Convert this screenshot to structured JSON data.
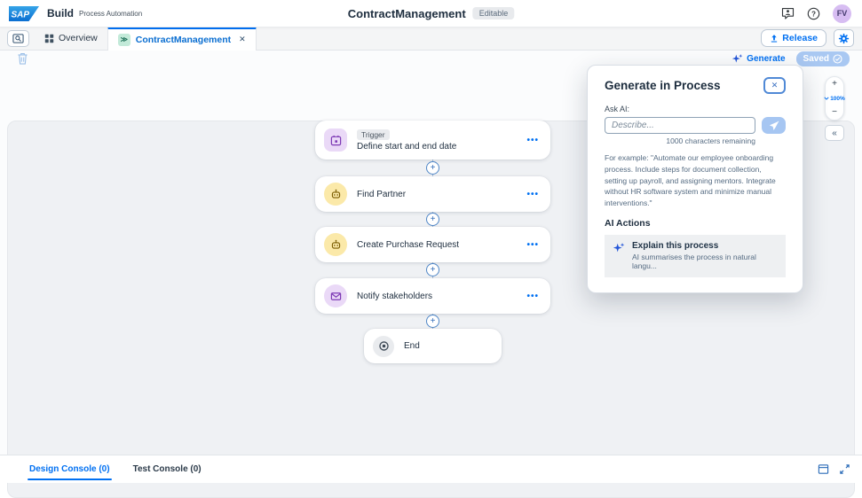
{
  "colors": {
    "accent": "#0070f2",
    "saved_bg": "#a9c8f2",
    "canvas_bg": "#eff1f4",
    "node_purple_bg": "#ead9f7",
    "node_purple_fg": "#7e3bb5",
    "node_yellow_bg": "#fbe9a9",
    "node_yellow_fg": "#7a5c00",
    "node_gray_bg": "#e9ebee",
    "ai_sparkle": "#2456d8",
    "avatar_bg": "#d7bdf2"
  },
  "header": {
    "logo": "SAP",
    "product": "Build",
    "product_suffix": "Process Automation",
    "title": "ContractManagement",
    "badge": "Editable",
    "avatar_initials": "FV"
  },
  "tabbar": {
    "overview": "Overview",
    "project": "ContractManagement",
    "project_chip": "≫",
    "close_glyph": "✕",
    "release": "Release"
  },
  "toolbar": {
    "generate": "Generate",
    "saved": "Saved"
  },
  "flow": {
    "add_glyph": "+",
    "overflow_glyph": "•••",
    "nodes": [
      {
        "badge": "Trigger",
        "title": "Define start and end date"
      },
      {
        "title": "Find Partner"
      },
      {
        "title": "Create Purchase Request"
      },
      {
        "title": "Notify stakeholders"
      },
      {
        "title": "End"
      }
    ]
  },
  "dialog": {
    "title": "Generate in Process",
    "close_glyph": "✕",
    "ask_label": "Ask AI:",
    "placeholder": "Describe...",
    "remaining": "1000 characters remaining",
    "example": "For example: \"Automate our employee onboarding process. Include steps for document collection, setting up payroll, and assigning mentors. Integrate without HR software system and minimize manual interventions.\"",
    "actions_heading": "AI Actions",
    "action_title": "Explain this process",
    "action_subtitle": "AI summarises the process in natural langu..."
  },
  "zoomctrl": {
    "plus": "+",
    "level": "100%",
    "minus": "−",
    "collapse": "«"
  },
  "console": {
    "design": "Design Console (0)",
    "test": "Test Console (0)"
  }
}
